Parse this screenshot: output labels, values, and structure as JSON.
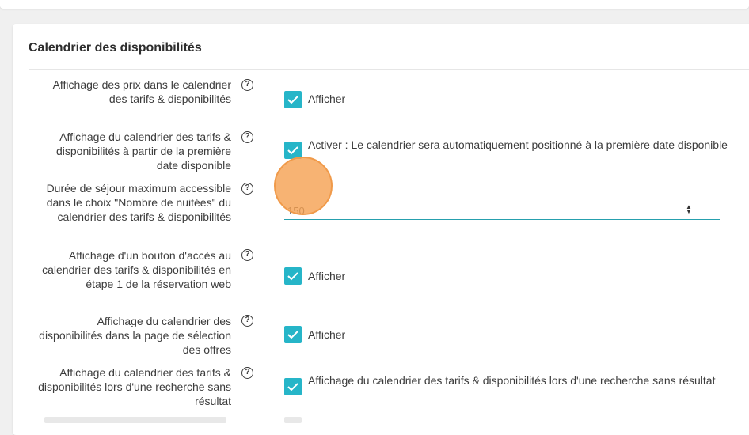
{
  "section": {
    "title": "Calendrier des disponibilités"
  },
  "rows": {
    "prices": {
      "label": "Affichage des prix dans le calendrier des tarifs & disponibilités",
      "checked": true,
      "option": "Afficher"
    },
    "first_date": {
      "label": "Affichage du calendrier des tarifs & disponibilités à partir de la première date disponible",
      "checked": true,
      "option": "Activer : Le calendrier sera automatiquement positionné à la première date disponible"
    },
    "max_stay": {
      "label": "Durée de séjour maximum accessible dans le choix \"Nombre de nuitées\" du calendrier des tarifs & disponibilités",
      "value": "150"
    },
    "access_button": {
      "label": "Affichage d'un bouton d'accès au calendrier des tarifs & disponibilités en étape 1 de la réservation web",
      "checked": true,
      "option": "Afficher"
    },
    "offers_page": {
      "label": "Affichage du calendrier des disponibilités dans la page de sélection des offres",
      "checked": true,
      "option": "Afficher"
    },
    "no_result": {
      "label": "Affichage du calendrier des tarifs & disponibilités lors d'une recherche sans résultat",
      "checked": true,
      "option": "Affichage du calendrier des tarifs & disponibilités lors d'une recherche sans résultat"
    }
  },
  "help_glyph": "?",
  "icons": {
    "help": "question-circle-icon",
    "check": "checkmark-icon",
    "spinner": "number-spinner-icon"
  },
  "colors": {
    "accent": "#26b5c8",
    "input_underline": "#26a0ae",
    "cursor_marker": "#f5a050"
  }
}
